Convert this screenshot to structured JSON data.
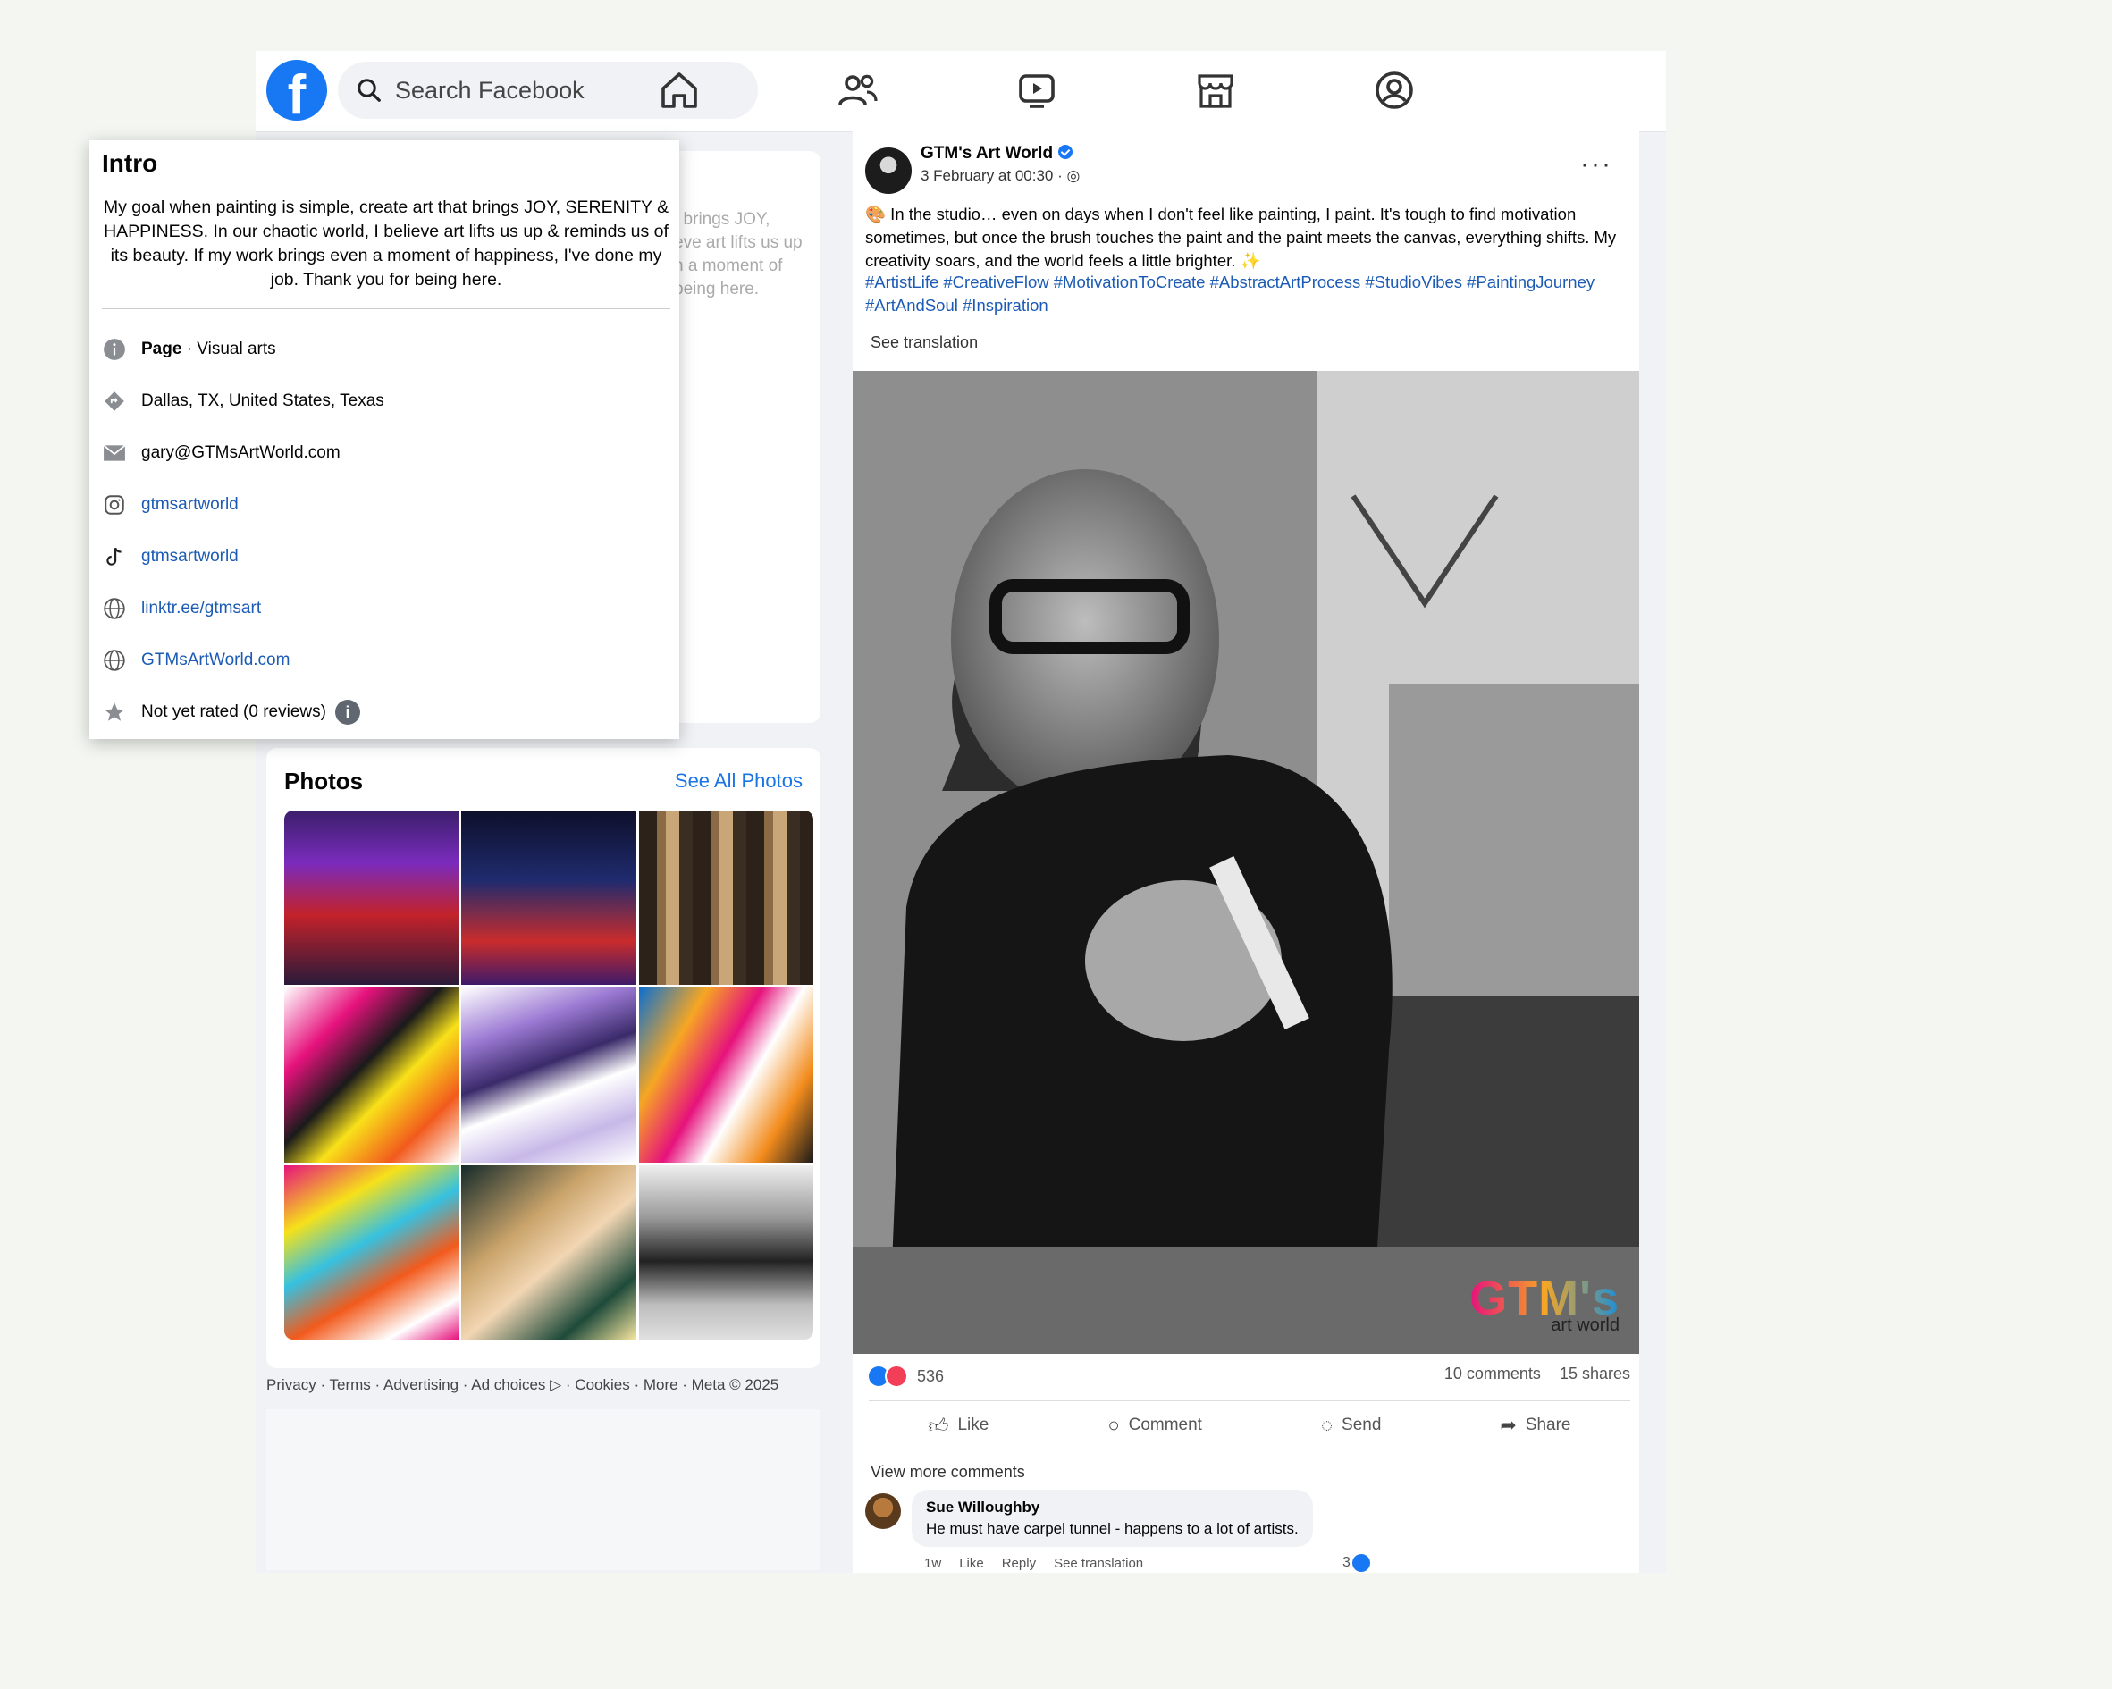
{
  "search": {
    "placeholder": "Search Facebook"
  },
  "nav": {
    "icons": [
      "home-icon",
      "friends-icon",
      "watch-icon",
      "marketplace-icon",
      "profile-icon"
    ]
  },
  "intro": {
    "title": "Intro",
    "bio": "My goal when painting is simple, create art that brings JOY, SERENITY & HAPPINESS. In our chaotic world, I believe art lifts us up & reminds us of its beauty. If my work brings even a moment of happiness, I've done my job. Thank you for being here.",
    "category_bold": "Page",
    "category_rest": " · Visual arts",
    "location": "Dallas, TX, United States, Texas",
    "email": "gary@GTMsArtWorld.com",
    "instagram": "gtmsartworld",
    "tiktok": "gtmsartworld",
    "link1": "linktr.ee/gtmsart",
    "link2": "GTMsArtWorld.com",
    "rating": "Not yet rated (0 reviews)"
  },
  "ghost": {
    "lines": [
      "t brings JOY,",
      "eve art lifts us up",
      "n a moment of",
      "being here."
    ]
  },
  "photos": {
    "title": "Photos",
    "see_all": "See All Photos"
  },
  "footer": "Privacy · Terms · Advertising · Ad choices ▷ · Cookies · More · Meta © 2025",
  "post": {
    "page_name": "GTM's Art World",
    "date": "3 February at 00:30 · ",
    "body": "🎨 In the studio… even on days when I don't feel like painting, I paint. It's tough to find motivation sometimes, but once the brush touches the paint and the paint meets the canvas, everything shifts. My creativity soars, and the world feels a little brighter. ✨",
    "hashtags": "#ArtistLife #CreativeFlow #MotivationToCreate #AbstractArtProcess #StudioVibes #PaintingJourney #ArtAndSoul #Inspiration",
    "see_translation": "See translation",
    "reactions": "536",
    "comments": "10 comments",
    "shares": "15 shares",
    "actions": {
      "like": "Like",
      "comment": "Comment",
      "send": "Send",
      "share": "Share"
    },
    "view_more": "View more comments",
    "watermark": "art world",
    "watermark_brand": "GTM's",
    "comment": {
      "name": "Sue Willoughby",
      "text": "He must have carpel tunnel - happens to a lot of artists.",
      "time": "1w",
      "like": "Like",
      "reply": "Reply",
      "translate": "See translation",
      "count": "3"
    }
  },
  "colors": {
    "brand": "#1877f2",
    "link": "#1b5bb5",
    "love": "#f33e58"
  }
}
